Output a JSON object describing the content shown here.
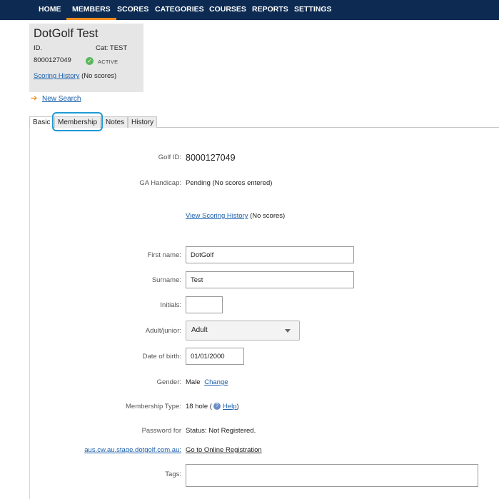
{
  "nav": {
    "items": [
      "HOME",
      "MEMBERS",
      "SCORES",
      "CATEGORIES",
      "COURSES",
      "REPORTS",
      "SETTINGS"
    ],
    "active": "MEMBERS"
  },
  "member": {
    "name": "DotGolf Test",
    "id_label": "ID.",
    "id_value": "8000127049",
    "cat_label": "Cat: TEST",
    "status": "ACTIVE",
    "scoring_history_link": "Scoring History",
    "scoring_history_note": "(No scores)"
  },
  "new_search": "New Search",
  "tabs": [
    "Basic",
    "Membership",
    "Notes",
    "History"
  ],
  "active_tab": "Basic",
  "highlighted_tab": "Membership",
  "form": {
    "golf_id_label": "Golf ID:",
    "golf_id_value": "8000127049",
    "handicap_label": "GA Handicap:",
    "handicap_value": "Pending (No scores entered)",
    "view_scoring_link": "View Scoring History",
    "view_scoring_note": "(No scores)",
    "first_name_label": "First name:",
    "first_name_value": "DotGolf",
    "surname_label": "Surname:",
    "surname_value": "Test",
    "initials_label": "Initials:",
    "initials_value": "",
    "adult_junior_label": "Adult/junior:",
    "adult_junior_value": "Adult",
    "dob_label": "Date of birth:",
    "dob_value": "01/01/2000",
    "gender_label": "Gender:",
    "gender_value": "Male",
    "gender_change_link": "Change",
    "membership_type_label": "Membership Type:",
    "membership_type_value": "18 hole (",
    "help_link": "Help",
    "membership_type_close": ")",
    "password_label": "Password for",
    "password_domain_link": "aus.cw.au.stage.dotgolf.com.au:",
    "password_status": "Status: Not Registered.",
    "online_registration_link": "Go to Online Registration",
    "tags_label": "Tags:",
    "tags_value": ""
  },
  "colors": {
    "nav_bg": "#0d2b52",
    "nav_active_underline": "#f08c1e",
    "link": "#1a5eab",
    "status_active": "#5bb85b",
    "tab_highlight": "#1e9bd7"
  },
  "icons": {
    "status": "check-circle-icon",
    "back": "arrow-left-icon",
    "help": "question-circle-icon",
    "dropdown": "caret-down-icon"
  }
}
